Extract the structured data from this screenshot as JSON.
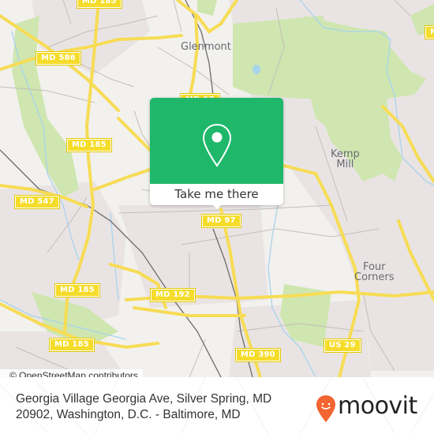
{
  "map": {
    "place_labels": [
      {
        "id": "glenmont",
        "text": "Glenmont"
      },
      {
        "id": "kemp-mill",
        "lines": [
          "Kemp",
          "Mill"
        ]
      },
      {
        "id": "four-corners",
        "lines": [
          "Four",
          "Corners"
        ]
      }
    ],
    "road_shields": [
      {
        "id": "md185-top",
        "text": "MD 185"
      },
      {
        "id": "md586",
        "text": "MD 586"
      },
      {
        "id": "md97-top",
        "text": "MD 97"
      },
      {
        "id": "md185-mid",
        "text": "MD 185"
      },
      {
        "id": "md547",
        "text": "MD 547"
      },
      {
        "id": "md97",
        "text": "MD 97"
      },
      {
        "id": "md185-low",
        "text": "MD 185"
      },
      {
        "id": "md192",
        "text": "MD 192"
      },
      {
        "id": "md185-bottom",
        "text": "MD 185"
      },
      {
        "id": "md390",
        "text": "MD 390"
      },
      {
        "id": "us29",
        "text": "US 29"
      },
      {
        "id": "md-right",
        "text": "MD"
      }
    ],
    "colors": {
      "background": "#f2f1ee",
      "residential": "#e9e4e3",
      "park": "#cfe6b0",
      "water": "#a8d3ec",
      "major_road": "#f7dc55",
      "minor_road": "#b8b3ad",
      "rail": "#6b6b6b"
    }
  },
  "popup": {
    "icon": "location-pin-icon",
    "button_label": "Take me there",
    "accent_color": "#1fb86a"
  },
  "attribution": "© OpenStreetMap contributors",
  "footer": {
    "address_line1": "Georgia Village Georgia Ave, Silver Spring, MD",
    "address_line2": "20902, Washington, D.C. - Baltimore, MD",
    "logo_text": "moovit",
    "logo_icon": "moovit-pin-icon",
    "logo_color": "#f26430"
  }
}
